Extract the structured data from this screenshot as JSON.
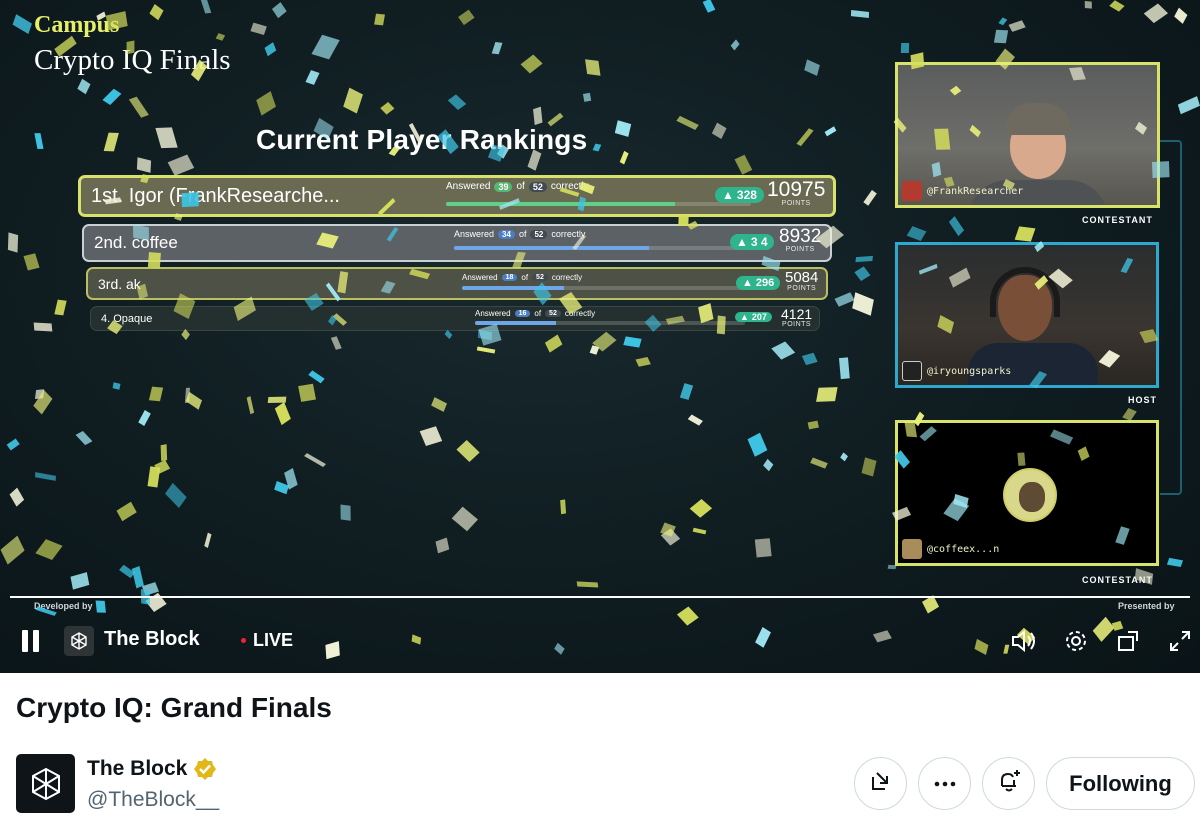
{
  "overlay": {
    "brand": "Campus",
    "event_title": "Crypto IQ Finals",
    "rankings_heading": "Current Player Rankings",
    "developed_by": "Developed by",
    "presented_by": "Presented by"
  },
  "rankings": [
    {
      "name": "1st. Igor (FrankResearche...",
      "answered_prefix": "Answered",
      "correct": "39",
      "of": "of",
      "total": "52",
      "suffix": "correctly",
      "progress": 0.75,
      "gain": "328",
      "points": "10975",
      "points_label": "POINTS"
    },
    {
      "name": "2nd. coffee",
      "answered_prefix": "Answered",
      "correct": "34",
      "of": "of",
      "total": "52",
      "suffix": "correctly",
      "progress": 0.65,
      "gain": "3 4",
      "points": "8932",
      "points_label": "POINTS"
    },
    {
      "name": "3rd. ak",
      "answered_prefix": "Answered",
      "correct": "18",
      "of": "of",
      "total": "52",
      "suffix": "correctly",
      "progress": 0.35,
      "gain": "296",
      "points": "5084",
      "points_label": "POINTS"
    },
    {
      "name": "4. Opaque",
      "answered_prefix": "Answered",
      "correct": "16",
      "of": "of",
      "total": "52",
      "suffix": "correctly",
      "progress": 0.3,
      "gain": "207",
      "points": "4121",
      "points_label": "POINTS"
    }
  ],
  "cameras": [
    {
      "handle": "@FrankResearcher",
      "role": "CONTESTANT"
    },
    {
      "handle": "@iryoungsparks",
      "role": "HOST"
    },
    {
      "handle": "@coffeex...n",
      "role": "CONTESTANT"
    }
  ],
  "player": {
    "channel": "The Block",
    "live": "LIVE"
  },
  "post": {
    "title": "Crypto IQ: Grand Finals",
    "account_name": "The Block",
    "account_handle": "@TheBlock__",
    "follow_label": "Following"
  },
  "colors": {
    "accent_yellow": "#d8e36a",
    "host_blue": "#2fa8cf",
    "gain_green": "#2fb58d",
    "live_red": "#f4212e",
    "verified_gold": "#e2b719"
  },
  "icons": [
    "pause-icon",
    "the-block-logo-icon",
    "volume-icon",
    "settings-gear-icon",
    "picture-in-picture-icon",
    "fullscreen-icon",
    "verified-badge-icon",
    "share-icon",
    "more-icon",
    "subscribe-icon"
  ]
}
